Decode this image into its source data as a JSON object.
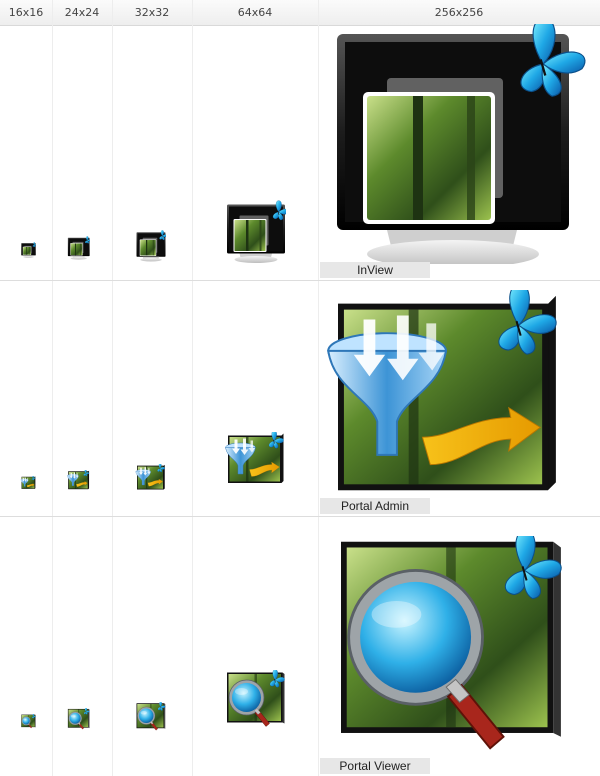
{
  "columns": [
    "16x16",
    "24x24",
    "32x32",
    "64x64",
    "256x256"
  ],
  "rows": [
    {
      "label": "InView",
      "icon": "monitor-butterfly-icon"
    },
    {
      "label": "Portal Admin",
      "icon": "funnel-screen-icon"
    },
    {
      "label": "Portal Viewer",
      "icon": "magnifier-screen-icon"
    }
  ],
  "colors": {
    "header_bg": "#f2f2f2",
    "label_bg": "#e7e7e7",
    "grid_line": "#e5e5e5",
    "butterfly": "#22aee8",
    "funnel": "#4ba3e0",
    "arrow": "#f0b400",
    "forest": "#4b7a2a",
    "magnifier_handle": "#a8261c"
  }
}
